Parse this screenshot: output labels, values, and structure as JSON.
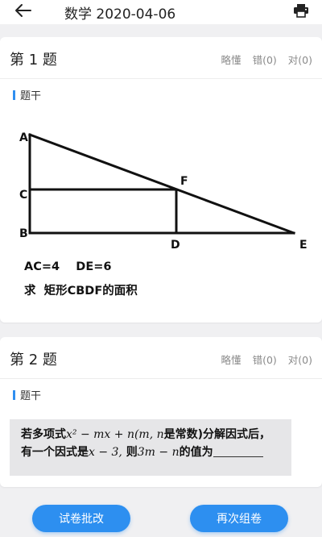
{
  "header": {
    "title": "数学 2020-04-06",
    "back_icon": "arrow-left-icon",
    "print_icon": "printer-icon"
  },
  "questions": [
    {
      "title": "第 1 题",
      "actions": [
        "略懂",
        "错(0)",
        "对(0)"
      ],
      "section_label": "题干",
      "figure_labels": {
        "A": "A",
        "B": "B",
        "C": "C",
        "D": "D",
        "E": "E",
        "F": "F"
      },
      "text_line1": "AC=4    DE=6",
      "text_line2": "求  矩形CBDF的面积"
    },
    {
      "title": "第 2 题",
      "actions": [
        "略懂",
        "错(0)",
        "对(0)"
      ],
      "section_label": "题干",
      "stem": {
        "part1": "若多项式",
        "expr1": "x² − mx + n(m, n",
        "part2": "是常数",
        "part3": ")分解因式后，",
        "part4": "有一个因式是",
        "expr2": "x − 3,",
        "part5": " 则",
        "expr3": "3m − n",
        "part6": "的值为"
      }
    }
  ],
  "footer": {
    "grade_button": "试卷批改",
    "regroup_button": "再次组卷"
  },
  "colors": {
    "accent": "#2d8ff0",
    "page_bg": "#f0f0f2",
    "stem_bg": "#e6e6e8"
  }
}
